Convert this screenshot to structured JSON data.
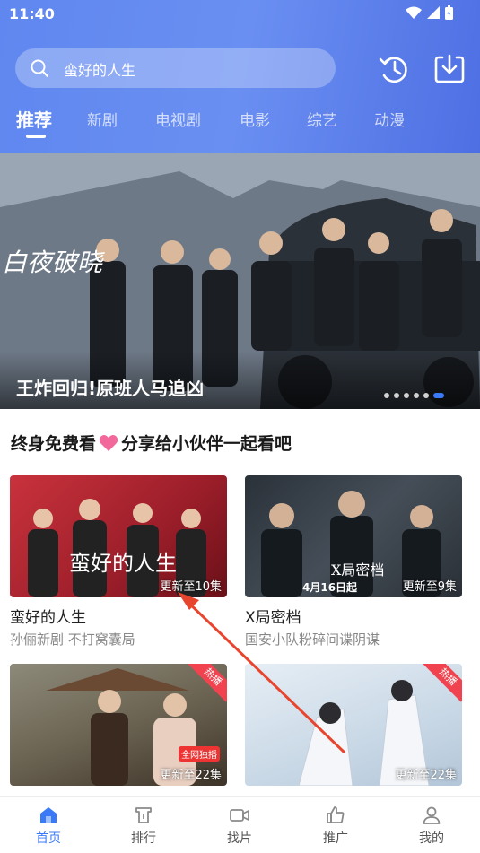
{
  "status_bar": {
    "time": "11:40"
  },
  "search": {
    "value": "蛮好的人生"
  },
  "tabs": [
    {
      "label": "推荐",
      "active": true
    },
    {
      "label": "新剧"
    },
    {
      "label": "电视剧"
    },
    {
      "label": "电影"
    },
    {
      "label": "综艺"
    },
    {
      "label": "动漫"
    }
  ],
  "banner": {
    "caption": "王炸回归!原班人马追凶",
    "title_art": "白夜破晓",
    "dots": 6,
    "active_dot": 6
  },
  "share": {
    "text_before": "终身免费看",
    "text_after": "分享给小伙伴一起看吧"
  },
  "cards": [
    {
      "title": "蛮好的人生",
      "desc": "孙俪新剧 不打窝囊局",
      "update": "更新至10集",
      "art": "蛮好的人生"
    },
    {
      "title": "X局密档",
      "desc": "国安小队粉碎间谍阴谋",
      "update": "更新至9集",
      "art": "X局密档",
      "date_text": "4月16日起"
    },
    {
      "title": "",
      "desc": "",
      "update": "更新至22集",
      "hot": "热播",
      "promo": "全网独播"
    },
    {
      "title": "",
      "desc": "",
      "update": "更新至22集",
      "hot": "热播"
    }
  ],
  "bottom_nav": [
    {
      "label": "首页",
      "icon": "home-icon",
      "active": true
    },
    {
      "label": "排行",
      "icon": "ranking-icon"
    },
    {
      "label": "找片",
      "icon": "video-camera-icon"
    },
    {
      "label": "推广",
      "icon": "thumbs-up-icon"
    },
    {
      "label": "我的",
      "icon": "user-icon"
    }
  ],
  "colors": {
    "accent": "#3b7af6",
    "header": "#6a8ff2",
    "hot": "#f0434f",
    "arrow": "#e8452f"
  }
}
